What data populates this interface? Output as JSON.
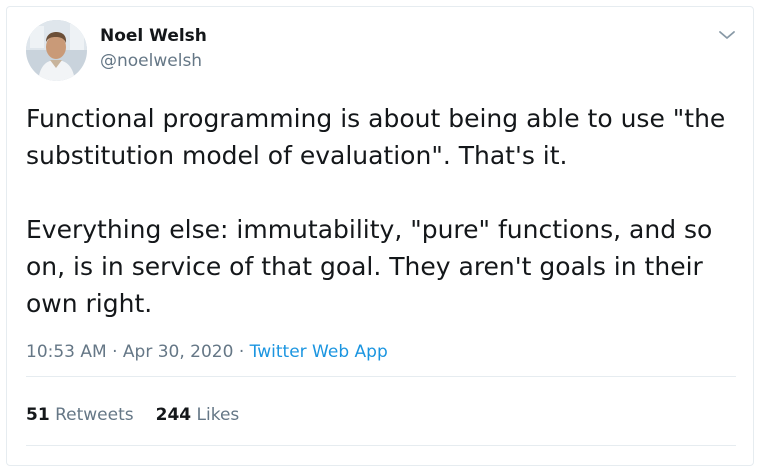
{
  "author": {
    "name": "Noel Welsh",
    "handle": "@noelwelsh"
  },
  "tweet": {
    "paragraphs": [
      "Functional programming is about being able to use \"the substitution model of evaluation\". That's it.",
      "Everything else: immutability, \"pure\" functions, and so on, is in service of that goal. They aren't goals in their own right."
    ],
    "time": "10:53 AM",
    "date": "Apr 30, 2020",
    "source": "Twitter Web App"
  },
  "stats": {
    "retweets_count": "51",
    "retweets_label": "Retweets",
    "likes_count": "244",
    "likes_label": "Likes"
  },
  "icons": {
    "menu": "chevron-down-icon"
  },
  "colors": {
    "text": "#14171a",
    "secondary": "#657786",
    "link": "#1b95e0",
    "border": "#e6ecf0"
  }
}
